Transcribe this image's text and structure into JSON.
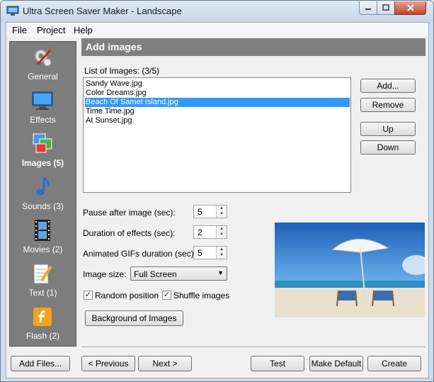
{
  "window": {
    "title": "Ultra Screen Saver Maker - Landscape"
  },
  "menu": {
    "items": [
      "File",
      "Project",
      "Help"
    ]
  },
  "sidebar": {
    "items": [
      {
        "label": "General",
        "icon": "gears-icon",
        "active": false
      },
      {
        "label": "Effects",
        "icon": "monitor-icon",
        "active": false
      },
      {
        "label": "Images (5)",
        "icon": "images-icon",
        "active": true
      },
      {
        "label": "Sounds (3)",
        "icon": "music-note-icon",
        "active": false
      },
      {
        "label": "Movies (2)",
        "icon": "film-strip-icon",
        "active": false
      },
      {
        "label": "Text (1)",
        "icon": "notepad-pencil-icon",
        "active": false
      },
      {
        "label": "Flash (2)",
        "icon": "flash-icon",
        "active": false
      }
    ]
  },
  "main": {
    "header": "Add images",
    "list_label": "List of Images:  (3/5)",
    "images": [
      {
        "name": "Sandy Wave.jpg",
        "selected": false
      },
      {
        "name": "Color Dreams.jpg",
        "selected": false
      },
      {
        "name": "Beach Of Samet Island.jpg",
        "selected": true
      },
      {
        "name": "Time Time.jpg",
        "selected": false
      },
      {
        "name": "At Sunset.jpg",
        "selected": false
      }
    ],
    "buttons": {
      "add": "Add...",
      "remove": "Remove",
      "up": "Up",
      "down": "Down"
    },
    "pause_label": "Pause after image (sec):",
    "pause_value": "5",
    "duration_label": "Duration of effects (sec):",
    "duration_value": "2",
    "gif_label": "Animated GIFs duration (sec):",
    "gif_value": "5",
    "size_label": "Image size:",
    "size_value": "Full Screen",
    "random_label": "Random position",
    "random_checked": true,
    "shuffle_label": "Shuffle images",
    "shuffle_checked": true,
    "background_button": "Background of Images"
  },
  "footer": {
    "add_files": "Add Files...",
    "previous": "< Previous",
    "next": "Next >",
    "test": "Test",
    "make_default": "Make Default",
    "create": "Create"
  },
  "colors": {
    "header_bar": "#808080",
    "sidebar": "#7d7d7d",
    "selection": "#3399ff"
  }
}
